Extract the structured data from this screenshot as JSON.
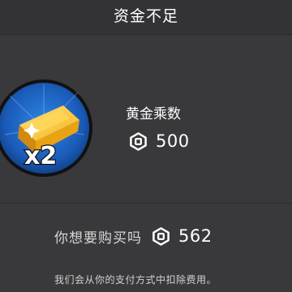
{
  "dialog": {
    "title": "资金不足"
  },
  "product": {
    "icon": "gold-bar-x2-icon",
    "badge": "x2",
    "name": "黄金乘数",
    "currency_icon": "robux-icon",
    "price": "500"
  },
  "purchase": {
    "question": "你想要购买吗",
    "currency_icon": "robux-icon",
    "amount": "562",
    "note": "我们会从你的支付方式中扣除费用。"
  },
  "colors": {
    "background": "#39393b",
    "icon_circle": "#1a5bb8",
    "gold": "#f2b21b"
  }
}
